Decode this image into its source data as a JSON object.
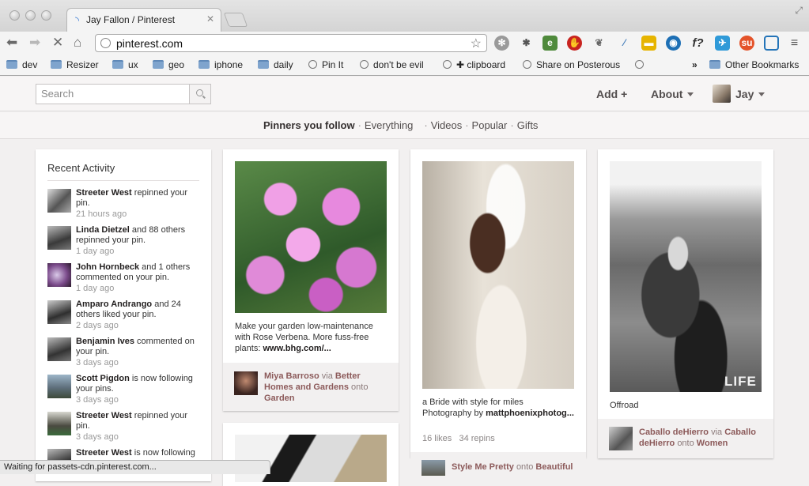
{
  "browser": {
    "tab_title": "Jay Fallon / Pinterest",
    "url": "pinterest.com",
    "bookmarks": [
      "dev",
      "Resizer",
      "ux",
      "geo",
      "iphone",
      "daily",
      "Pin It",
      "don't be evil",
      "✚ clipboard",
      "Share on Posterous"
    ],
    "overflow_label": "»",
    "other_bookmarks": "Other Bookmarks",
    "status": "Waiting for passets-cdn.pinterest.com..."
  },
  "header": {
    "search_placeholder": "Search",
    "add": "Add +",
    "about": "About",
    "user": "Jay"
  },
  "subnav": {
    "active": "Pinners you follow",
    "items": [
      "Everything",
      "Videos",
      "Popular",
      "Gifts"
    ]
  },
  "recent": {
    "title": "Recent Activity",
    "items": [
      {
        "name": "Streeter West",
        "action": "repinned your pin.",
        "time": "21 hours ago"
      },
      {
        "name": "Linda Dietzel",
        "action": "and 88 others repinned your pin.",
        "time": "1 day ago"
      },
      {
        "name": "John Hornbeck",
        "action": "and 1 others commented on your pin.",
        "time": "1 day ago"
      },
      {
        "name": "Amparo Andrango",
        "action": "and 24 others liked your pin.",
        "time": "2 days ago"
      },
      {
        "name": "Benjamin Ives",
        "action": "commented on your pin.",
        "time": "3 days ago"
      },
      {
        "name": "Scott Pigdon",
        "action": "is now following your pins.",
        "time": "3 days ago"
      },
      {
        "name": "Streeter West",
        "action": "repinned your pin.",
        "time": "3 days ago"
      },
      {
        "name": "Streeter West",
        "action": "is now following",
        "time": ""
      }
    ]
  },
  "pins": {
    "verbena": {
      "desc": "Make your garden low-maintenance with Rose Verbena. More fuss-free plants: ",
      "link": "www.bhg.com/...",
      "pinner": "Miya Barroso",
      "via": "via",
      "source": "Better Homes and Gardens",
      "onto": "onto",
      "board": "Garden"
    },
    "bride": {
      "desc": "a Bride with style for miles Photography by ",
      "link": "mattphoenixphotog...",
      "likes": "16 likes",
      "repins": "34 repins",
      "pinner": "Style Me Pretty",
      "onto": "onto",
      "board": "Beautiful"
    },
    "offroad": {
      "desc": "Offroad",
      "pinner": "Caballo deHierro",
      "via": "via",
      "source": "Caballo deHierro",
      "onto": "onto",
      "board": "Women",
      "watermark": "LIFE"
    }
  }
}
